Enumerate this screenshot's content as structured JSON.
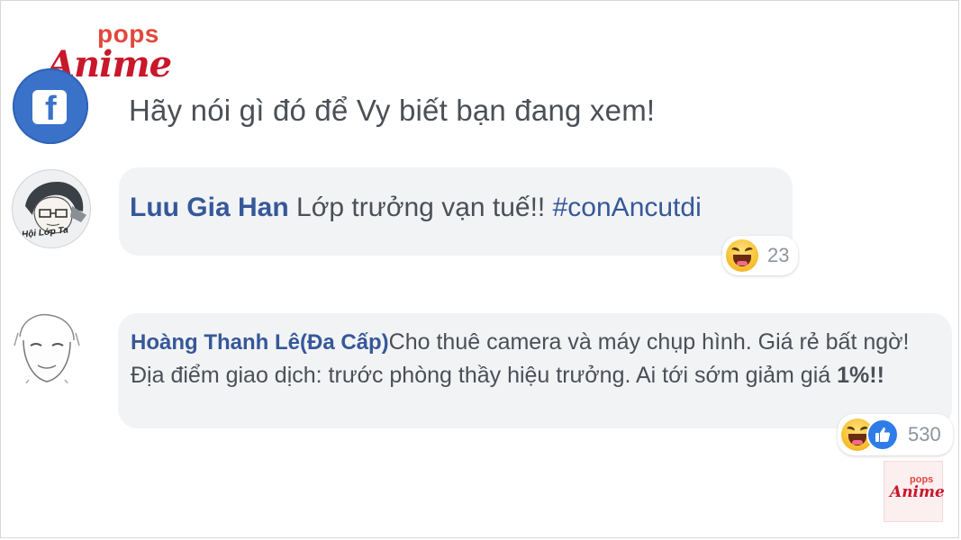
{
  "logo": {
    "top_word": "pops",
    "main_word": "Anime"
  },
  "prompt": {
    "icon": "facebook-icon",
    "text": "Hãy nói gì đó để Vy biết bạn đang xem!"
  },
  "comments": [
    {
      "author": "Luu Gia Han",
      "text": "Lớp trưởng vạn tuế!!",
      "hashtag": "#conAncutdi",
      "avatar_icon": "sketch-portrait-avatar",
      "avatar_caption": "Hội Lớp Ta",
      "reactions": {
        "icons": [
          "haha-icon"
        ],
        "count": "23"
      }
    },
    {
      "author": "Hoàng Thanh Lê(Đa Cấp)",
      "text": "Cho thuê camera và máy chụp hình. Giá rẻ bất ngờ! Địa điểm giao dịch: trước phòng thầy hiệu trưởng. Ai tới sớm giảm giá ",
      "text_bold": "1%!!",
      "avatar_icon": "sketch-old-man-avatar",
      "reactions": {
        "icons": [
          "haha-icon",
          "like-icon"
        ],
        "count": "530"
      }
    }
  ],
  "watermark": {
    "top_word": "pops",
    "main_word": "Anime"
  },
  "colors": {
    "author": "#365899",
    "bubble": "#f2f3f5",
    "facebook_blue": "#3b72c9",
    "logo_red": "#c9172b"
  }
}
